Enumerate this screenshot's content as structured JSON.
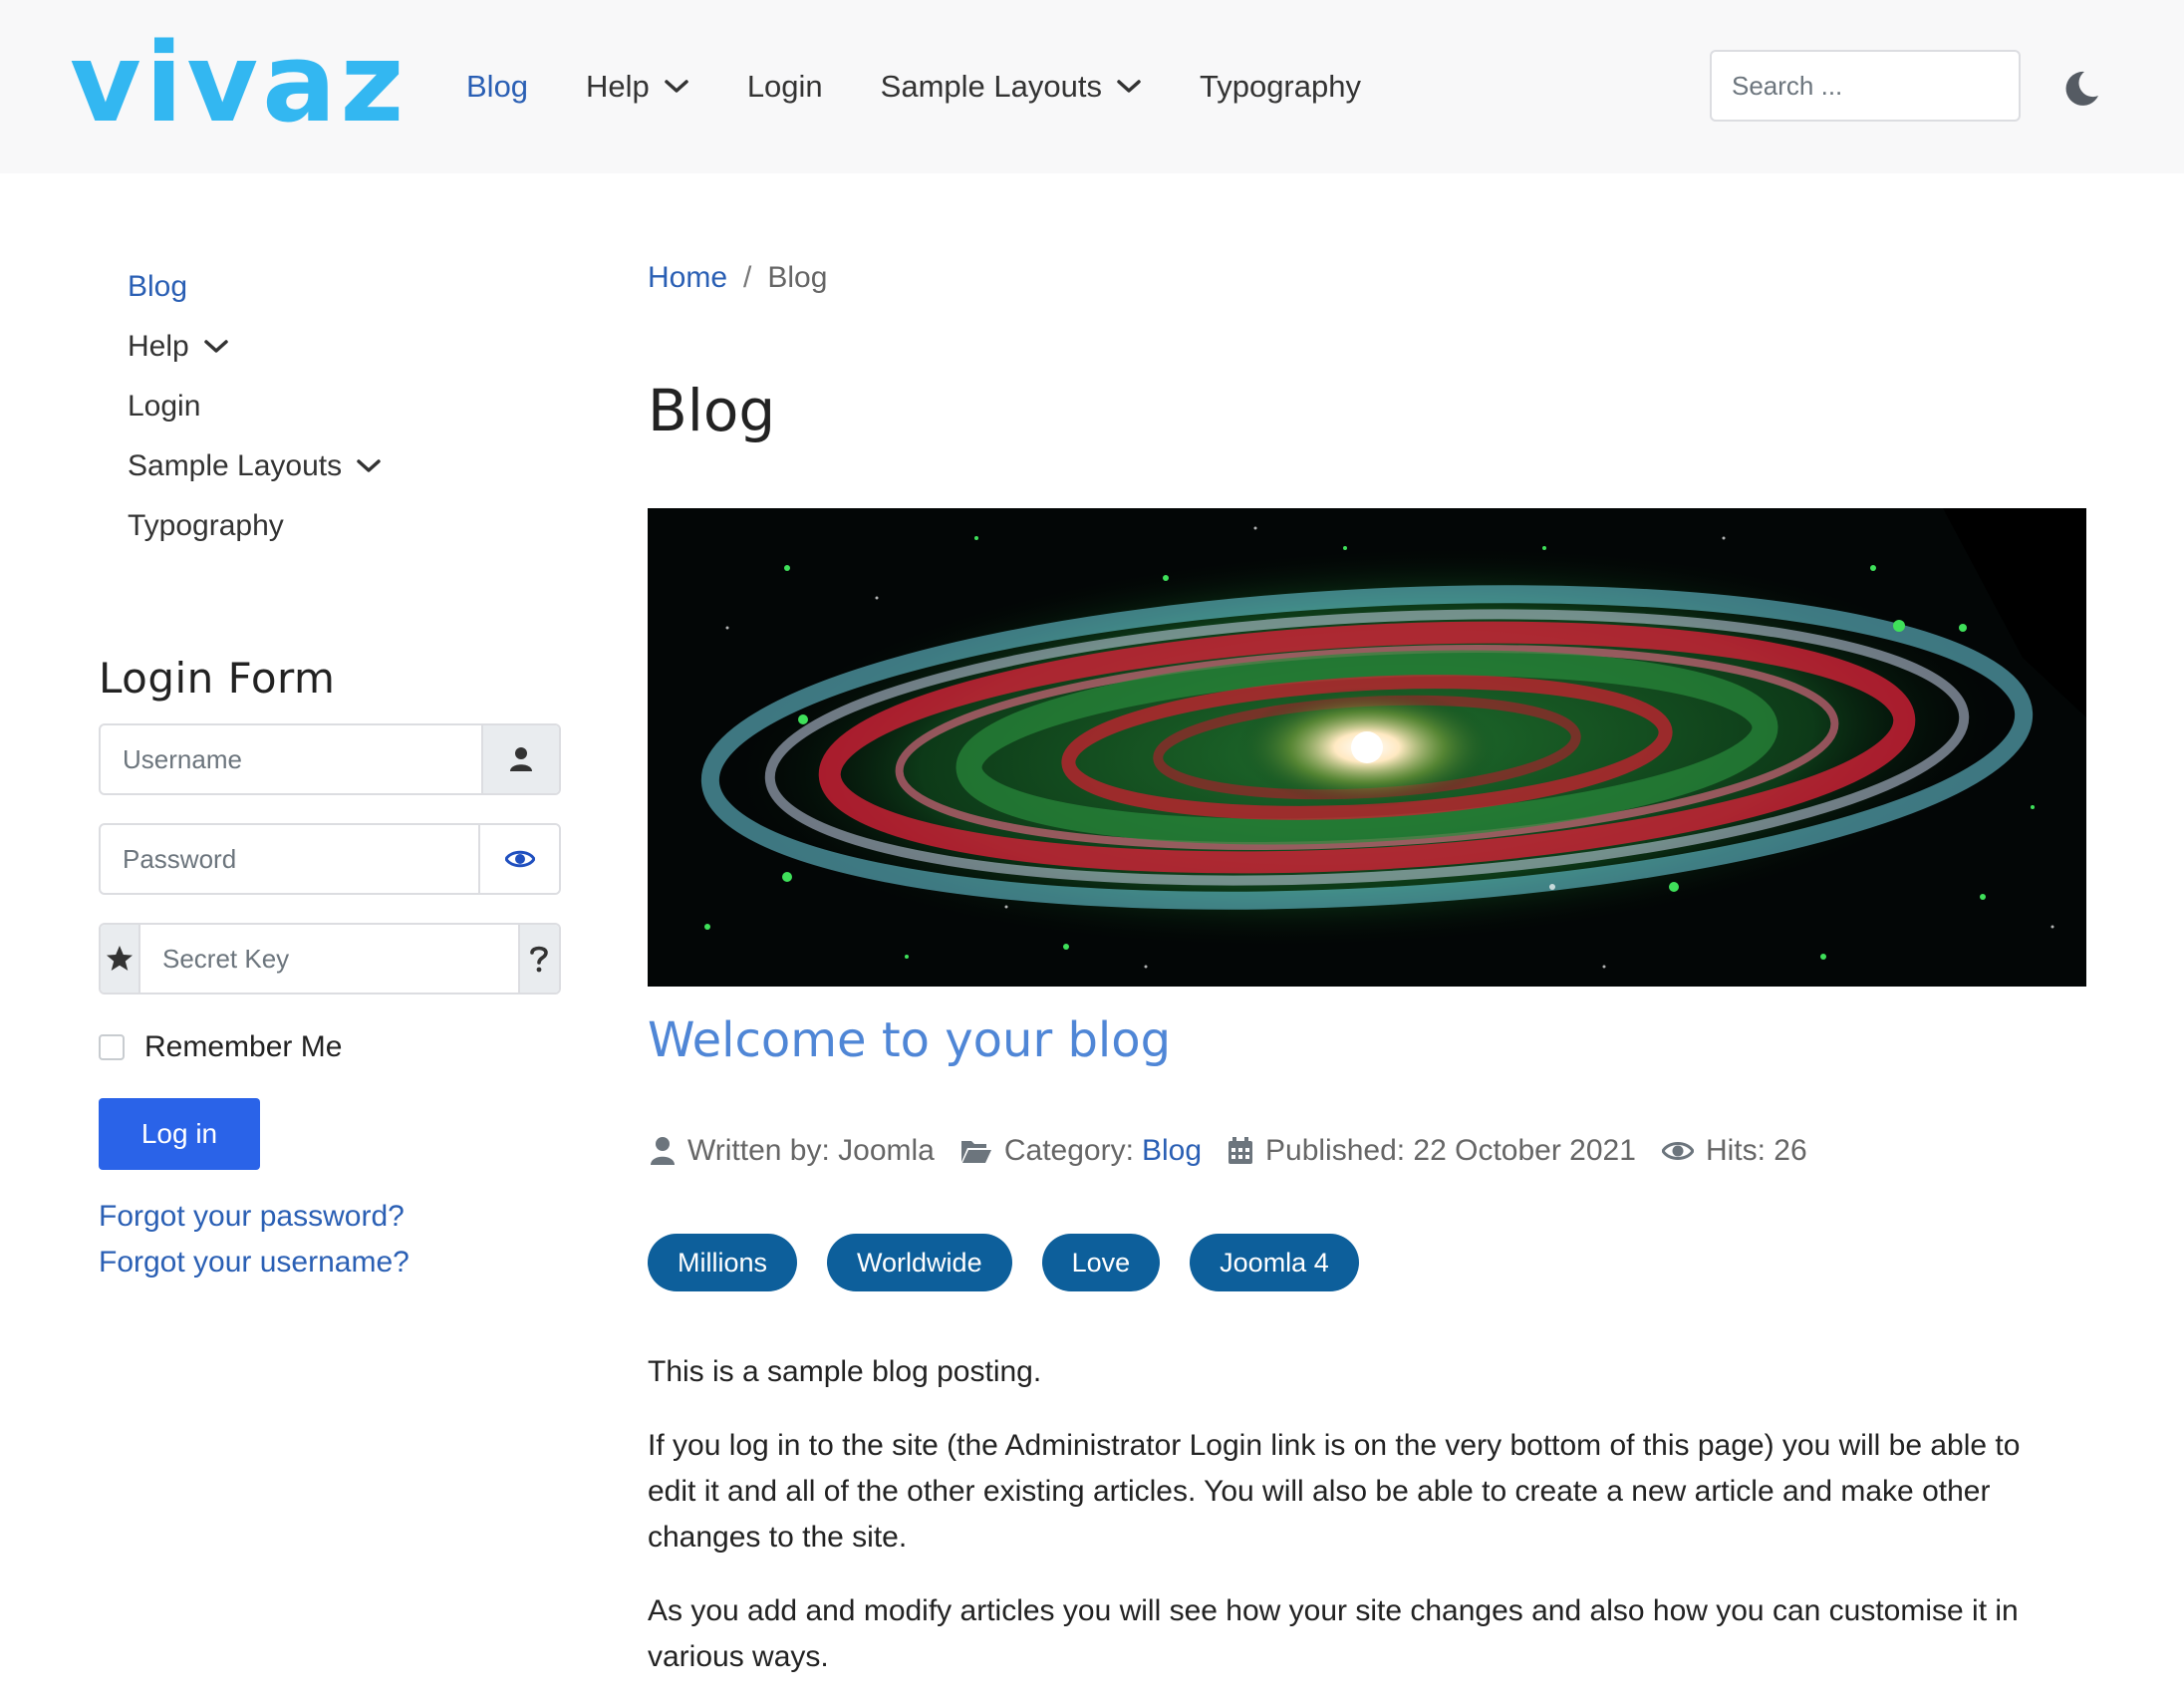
{
  "header": {
    "logo": "vivaz",
    "nav": [
      {
        "label": "Blog"
      },
      {
        "label": "Help"
      },
      {
        "label": "Login"
      },
      {
        "label": "Sample Layouts"
      },
      {
        "label": "Typography"
      }
    ],
    "search_placeholder": "Search ..."
  },
  "sidebar": {
    "menu": [
      {
        "label": "Blog"
      },
      {
        "label": "Help"
      },
      {
        "label": "Login"
      },
      {
        "label": "Sample Layouts"
      },
      {
        "label": "Typography"
      }
    ],
    "login_form": {
      "title": "Login Form",
      "username_placeholder": "Username",
      "password_placeholder": "Password",
      "secret_key_placeholder": "Secret Key",
      "remember_label": "Remember Me",
      "login_button": "Log in",
      "forgot_password": "Forgot your password?",
      "forgot_username": "Forgot your username?"
    }
  },
  "main": {
    "breadcrumb": {
      "home": "Home",
      "separator": "/",
      "current": "Blog"
    },
    "page_title": "Blog",
    "article": {
      "title": "Welcome to your blog",
      "meta": {
        "author_label": "Written by: Joomla",
        "category_label": "Category:",
        "category_link": "Blog",
        "published": "Published: 22 October 2021",
        "hits": "Hits: 26"
      },
      "tags": [
        "Millions",
        "Worldwide",
        "Love",
        "Joomla 4"
      ],
      "paragraphs": [
        "This is a sample blog posting.",
        "If you log in to the site (the Administrator Login link is on the very bottom of this page) you will be able to edit it and all of the other existing articles. You will also be able to create a new article and make other changes to the site.",
        "As you add and modify articles you will see how your site changes and also how you can customise it in various ways."
      ]
    }
  },
  "colors": {
    "logo": "#33b7f1",
    "link": "#2a5fb4",
    "button": "#2a63e8",
    "tag": "#0d5f9b",
    "header_bg": "#f8f8f9"
  }
}
